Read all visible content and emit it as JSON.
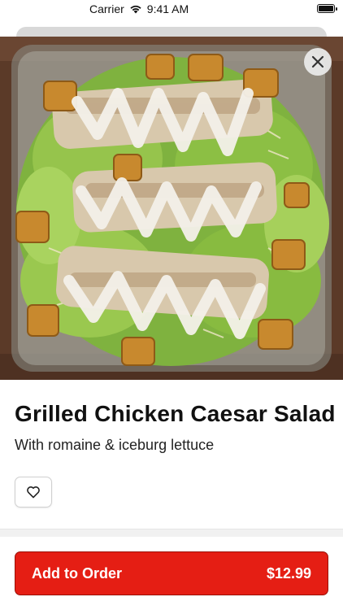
{
  "status_bar": {
    "carrier": "Carrier",
    "time": "9:41 AM"
  },
  "item": {
    "name": "Grilled Chicken Caesar Salad",
    "description": "With romaine & iceburg lettuce"
  },
  "order": {
    "label": "Add to Order",
    "price": "$12.99"
  },
  "colors": {
    "accent": "#e51e14",
    "accent_border": "#9b1008"
  },
  "icons": {
    "close": "close-icon",
    "favorite": "heart-icon",
    "wifi": "wifi-icon",
    "battery": "battery-icon"
  }
}
